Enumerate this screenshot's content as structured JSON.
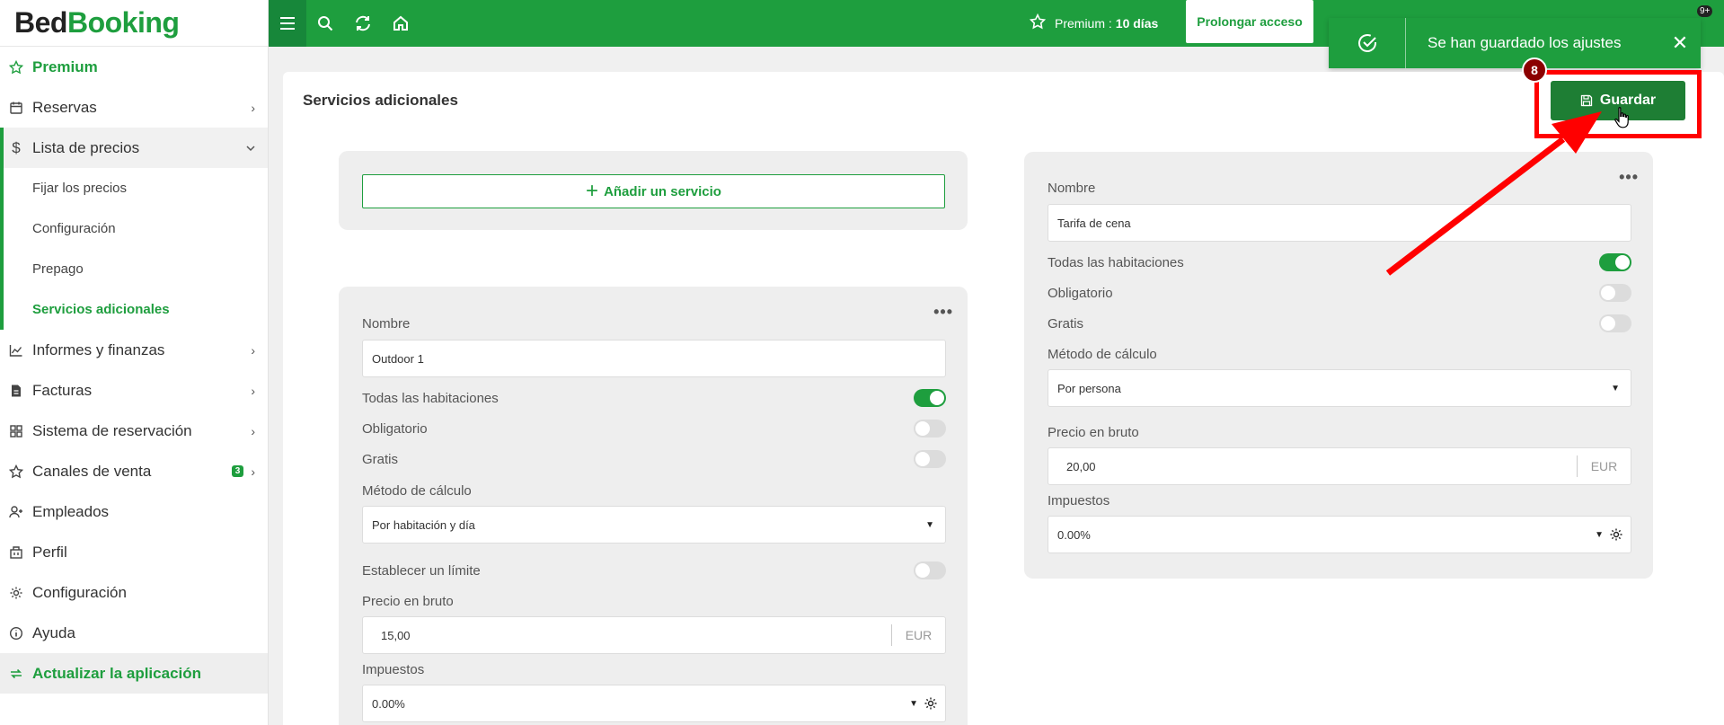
{
  "logo": {
    "part1": "Bed",
    "part2": "Booking"
  },
  "sidebar": {
    "premium": "Premium",
    "items": [
      {
        "label": "Reservas"
      },
      {
        "label": "Lista de precios"
      },
      {
        "label": "Informes y finanzas"
      },
      {
        "label": "Facturas"
      },
      {
        "label": "Sistema de reservación"
      },
      {
        "label": "Canales de venta",
        "badge": "3"
      },
      {
        "label": "Empleados"
      },
      {
        "label": "Perfil"
      },
      {
        "label": "Configuración"
      },
      {
        "label": "Ayuda"
      }
    ],
    "sub_items": [
      "Fijar los precios",
      "Configuración",
      "Prepago",
      "Servicios adicionales"
    ],
    "update": "Actualizar la aplicación"
  },
  "topbar": {
    "premium_prefix": "Premium :",
    "premium_days": "10 días",
    "prolong": "Prolongar acceso",
    "notifications_badge": "9+"
  },
  "toast": {
    "message": "Se han guardado los ajustes",
    "close": "✕"
  },
  "main": {
    "title": "Servicios adicionales",
    "save": "Guardar",
    "step": "8",
    "add_service": "Añadir un servicio"
  },
  "service1": {
    "name_label": "Nombre",
    "name": "Outdoor 1",
    "all_rooms": "Todas las habitaciones",
    "mandatory": "Obligatorio",
    "free": "Gratis",
    "calc_label": "Método de cálculo",
    "calc": "Por habitación y día",
    "limit": "Establecer un límite",
    "price_label": "Precio en bruto",
    "price": "15,00",
    "currency": "EUR",
    "tax_label": "Impuestos",
    "tax": "0.00%"
  },
  "service2": {
    "name_label": "Nombre",
    "name": "Tarifa de cena",
    "all_rooms": "Todas las habitaciones",
    "mandatory": "Obligatorio",
    "free": "Gratis",
    "calc_label": "Método de cálculo",
    "calc": "Por persona",
    "price_label": "Precio en bruto",
    "price": "20,00",
    "currency": "EUR",
    "tax_label": "Impuestos",
    "tax": "0.00%"
  },
  "colors": {
    "brand": "#1e9e3e",
    "highlight": "#ff0000",
    "step_badge": "#8b0000"
  }
}
